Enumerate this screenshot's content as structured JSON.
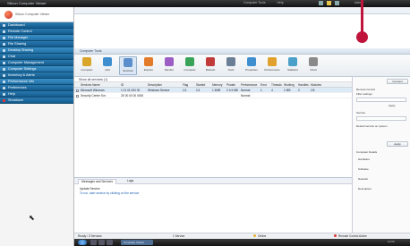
{
  "topbar": {
    "title": "Silicon Computer Viewer",
    "links": [
      "Computer Tools",
      "Help"
    ],
    "user": "Admin"
  },
  "sidebar": {
    "items": [
      {
        "label": "Dashboard",
        "red": false,
        "sub": false
      },
      {
        "label": "Remote Control",
        "red": false,
        "sub": false
      },
      {
        "label": "File Manager",
        "red": false,
        "sub": true
      },
      {
        "label": "File Sharing",
        "red": false,
        "sub": false
      },
      {
        "label": "Desktop Sharing",
        "red": false,
        "sub": true
      },
      {
        "label": "Chat",
        "red": false,
        "sub": false
      },
      {
        "label": "Computer Management",
        "red": false,
        "sub": false
      },
      {
        "label": "Computer Settings",
        "red": false,
        "sub": true
      },
      {
        "label": "Inventory & Alerts",
        "red": false,
        "sub": false
      },
      {
        "label": "Performance Info",
        "red": false,
        "sub": true
      },
      {
        "label": "Preferences",
        "red": false,
        "sub": false
      },
      {
        "label": "Help",
        "red": false,
        "sub": false
      },
      {
        "label": "Shutdown",
        "red": true,
        "sub": false
      }
    ]
  },
  "pane": {
    "title": "Computer Tools"
  },
  "toolbar": {
    "tools": [
      {
        "label": "Computer",
        "color": "#d9a52b"
      },
      {
        "label": "Add",
        "color": "#3f8fd0"
      },
      {
        "label": "Services",
        "color": "#5b8fcb",
        "active": true
      },
      {
        "label": "Explore",
        "color": "#e27b2a"
      },
      {
        "label": "Monitor",
        "color": "#9c5ec4"
      },
      {
        "label": "Computer",
        "color": "#3aa35a"
      },
      {
        "label": "Refresh",
        "color": "#c23b3b"
      },
      {
        "label": "Tools",
        "color": "#6a7f95"
      },
      {
        "label": "Properties",
        "color": "#3f8fd0"
      },
      {
        "label": "Performance",
        "color": "#e0a12f"
      },
      {
        "label": "Statistics",
        "color": "#4aa0c8"
      },
      {
        "label": "Chart",
        "color": "#8a8a8a"
      }
    ]
  },
  "filter": {
    "label": "Show all services (1)"
  },
  "grid": {
    "columns": [
      "Services Name",
      "ID",
      "Description",
      "Flag",
      "Started",
      "Memory",
      "Private",
      "Performance",
      "Error",
      "Threads",
      "Working",
      "Handles",
      "Modules"
    ],
    "rows": [
      [
        "Microsoft Windows",
        "1 01 01 000 00",
        "Windows Service",
        "1/1",
        "1/1",
        "1 4MB",
        "2 1/4 MB",
        "Normal",
        "1",
        "4",
        "1 MB",
        "2",
        "1/5"
      ],
      [
        "Security Center Svc",
        "2E 00 00 00 0000",
        "",
        "",
        "",
        "",
        "",
        "Normal",
        "",
        "",
        "",
        "",
        ""
      ]
    ]
  },
  "rightpanel": {
    "search_btn": "Connect",
    "lines": [
      "Remote Control",
      "Filter settings",
      "Apply",
      "Service",
      "Restart service on system",
      "Computer Details",
      "Hardware",
      "Software",
      "Network",
      "Description"
    ],
    "apply_btn": "Apply"
  },
  "bottom": {
    "tabs": [
      "Messages and Services",
      "Logs"
    ],
    "status_line": "Update Service",
    "link_line": "To run, start service by clicking on the service"
  },
  "status": {
    "left": "Ready / 0 Services",
    "mid": "1 Service",
    "right": "Online",
    "far": "Remote Control Active"
  },
  "taskbar": {
    "app": "Computer Viewer",
    "clock": "12:00"
  }
}
